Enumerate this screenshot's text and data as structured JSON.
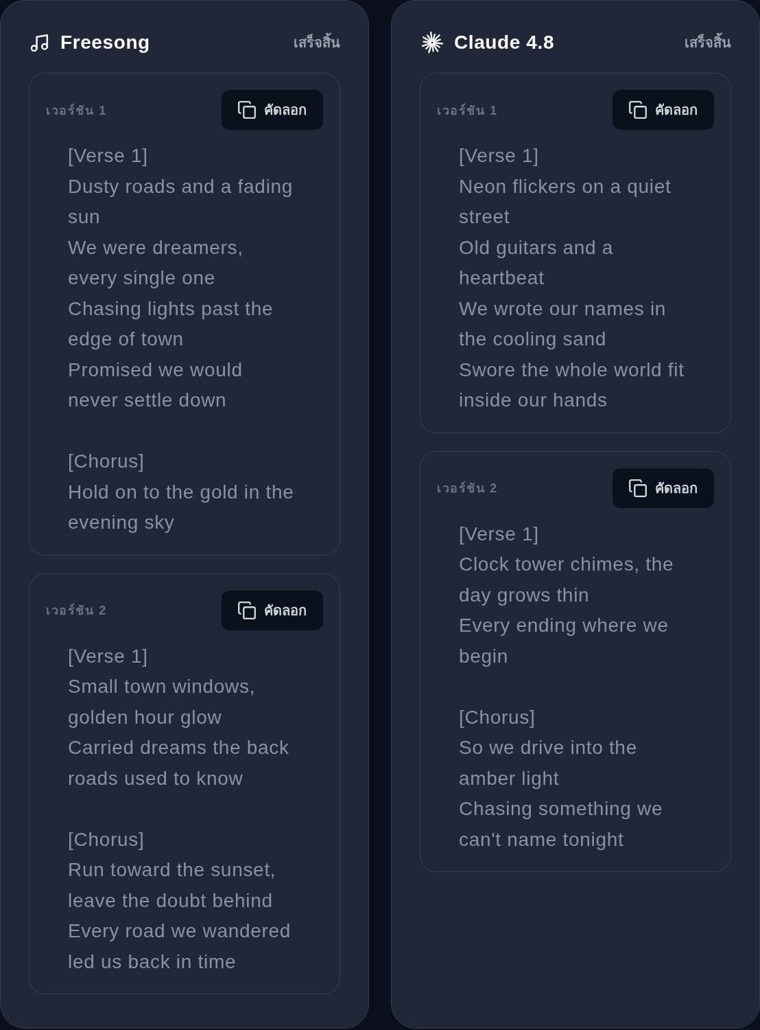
{
  "panels": [
    {
      "kind": "song_tool",
      "title": "Freesong",
      "status": "เสร็จสิ้น",
      "versions": [
        {
          "label": "เวอร์ชัน 1",
          "copy_label": "คัดลอก",
          "sections": [
            {
              "heading": "[Verse 1]",
              "lines": [
                "Dusty roads and a fading sun",
                "We were dreamers, every single one",
                "Chasing lights past the edge of town",
                "Promised we would never settle down"
              ]
            },
            {
              "heading": "[Chorus]",
              "lines": [
                "Hold on to the gold in the evening sky"
              ]
            }
          ]
        },
        {
          "label": "เวอร์ชัน 2",
          "copy_label": "คัดลอก",
          "sections": [
            {
              "heading": "[Verse 1]",
              "lines": [
                "Small town windows, golden hour glow",
                "Carried dreams the back roads used to know"
              ]
            },
            {
              "heading": "[Chorus]",
              "lines": [
                "Run toward the sunset, leave the doubt behind",
                "Every road we wandered led us back in time"
              ]
            }
          ]
        }
      ]
    },
    {
      "kind": "ai_model",
      "title": "Claude 4.8",
      "status": "เสร็จสิ้น",
      "versions": [
        {
          "label": "เวอร์ชัน 1",
          "copy_label": "คัดลอก",
          "sections": [
            {
              "heading": "[Verse 1]",
              "lines": [
                "Neon flickers on a quiet street",
                "Old guitars and a heartbeat",
                "We wrote our names in the cooling sand",
                "Swore the whole world fit inside our hands"
              ]
            }
          ]
        },
        {
          "label": "เวอร์ชัน 2",
          "copy_label": "คัดลอก",
          "sections": [
            {
              "heading": "[Verse 1]",
              "lines": [
                "Clock tower chimes, the day grows thin",
                "Every ending where we begin"
              ]
            },
            {
              "heading": "[Chorus]",
              "lines": [
                "So we drive into the amber light",
                "Chasing something we can't name tonight"
              ]
            }
          ]
        }
      ]
    }
  ]
}
